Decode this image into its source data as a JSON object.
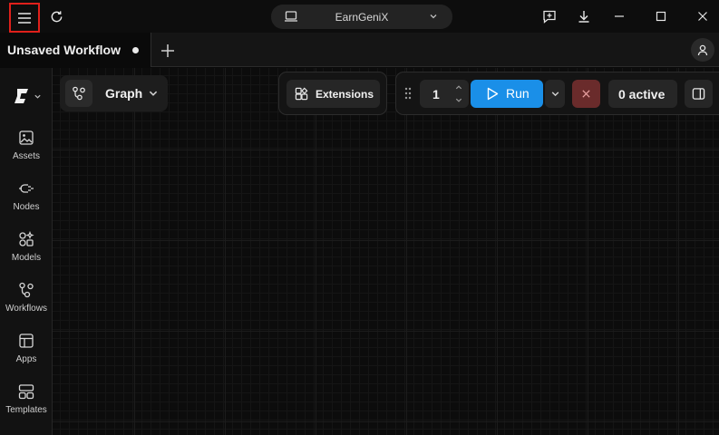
{
  "titlebar": {
    "workspace_name": "EarnGeniX",
    "icons": [
      "menu-icon",
      "refresh-icon",
      "laptop-icon",
      "chevron-down-icon",
      "feedback-icon",
      "download-icon",
      "minimize-icon",
      "maximize-icon",
      "close-icon"
    ]
  },
  "tabs": [
    {
      "title": "Unsaved Workflow",
      "unsaved": true
    }
  ],
  "sidebar": {
    "items": [
      {
        "label": "Assets",
        "icon": "image-icon"
      },
      {
        "label": "Nodes",
        "icon": "plug-icon"
      },
      {
        "label": "Models",
        "icon": "shapes-icon"
      },
      {
        "label": "Workflows",
        "icon": "workflow-icon"
      },
      {
        "label": "Apps",
        "icon": "layout-icon"
      },
      {
        "label": "Templates",
        "icon": "templates-icon"
      }
    ]
  },
  "toolbar": {
    "graph_label": "Graph",
    "extensions_label": "Extensions",
    "queue_count": "1",
    "run_label": "Run",
    "active_label": "0 active"
  },
  "colors": {
    "accent": "#1a8fe8",
    "stop": "#6a2b2b",
    "highlight": "#e0201b"
  }
}
